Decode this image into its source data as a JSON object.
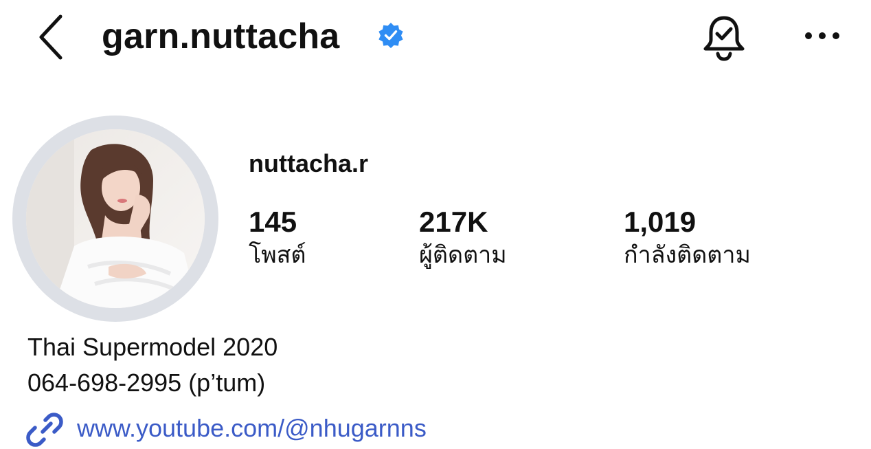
{
  "header": {
    "username": "garn.nuttacha",
    "icons": {
      "back": "chevron-left-icon",
      "verified": "verified-badge-icon",
      "notifications": "bell-check-icon",
      "more": "more-horizontal-icon"
    }
  },
  "profile": {
    "display_name": "nuttacha.r",
    "stats": [
      {
        "value": "145",
        "label": "โพสต์"
      },
      {
        "value": "217K",
        "label": "ผู้ติดตาม"
      },
      {
        "value": "1,019",
        "label": "กำลังติดตาม"
      }
    ],
    "bio": [
      "Thai Supermodel 2020",
      "064-698-2995 (p’tum)"
    ],
    "link": {
      "text": "www.youtube.com/@nhugarnns",
      "icon": "link-icon"
    }
  },
  "colors": {
    "verified": "#2f8df4",
    "link": "#3b5bc7",
    "avatar_ring": "#dde0e6"
  }
}
